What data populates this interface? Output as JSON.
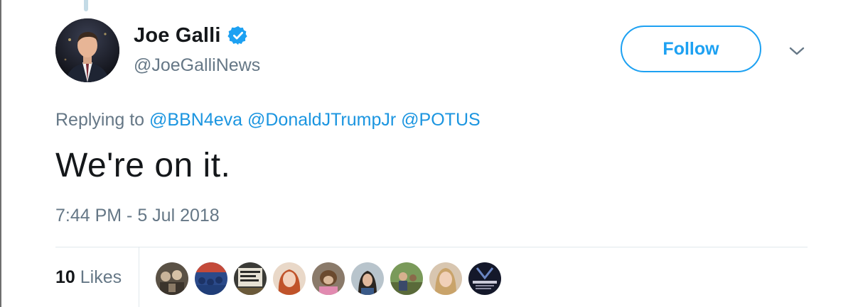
{
  "tweet": {
    "author": {
      "display_name": "Joe Galli",
      "handle": "@JoeGalliNews",
      "verified": true
    },
    "follow_label": "Follow",
    "replying_prefix": "Replying to",
    "mentions": [
      "@BBN4eva",
      "@DonaldJTrumpJr",
      "@POTUS"
    ],
    "text": "We're on it.",
    "timestamp": "7:44 PM - 5 Jul 2018",
    "likes": {
      "count": "10",
      "label": "Likes"
    },
    "liker_avatar_count": 9
  },
  "icons": {
    "verified": "verified-badge-icon",
    "more": "chevron-down-icon"
  },
  "colors": {
    "accent": "#1da1f2",
    "mention": "#1b95e0",
    "muted_text": "#657786",
    "primary_text": "#14171a",
    "divider": "#e1e8ed"
  }
}
